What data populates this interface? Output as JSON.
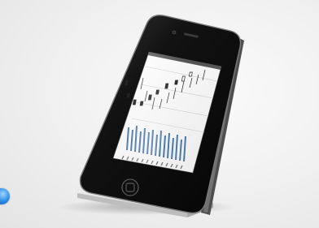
{
  "scene": {
    "subject": "smartphone-on-stand",
    "screen_content": "stock-chart",
    "colors": {
      "background": "#f1f1f1",
      "phone_body": "#141414",
      "bezel_edge": "#6f6f6f",
      "screen_bg": "#f7f7f7",
      "volume_bars": "#4a78a8",
      "candle": "#222222",
      "stand": "#e2e2e2",
      "badge": "#2f8fe6"
    },
    "icons": [
      "home-button-icon",
      "camera-icon",
      "speaker-icon",
      "corner-badge-icon"
    ]
  }
}
